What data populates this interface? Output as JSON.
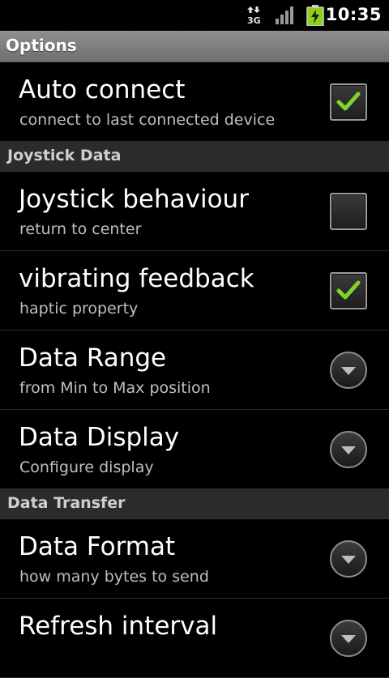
{
  "status_bar": {
    "time": "10:35",
    "network_label": "3G",
    "icons": [
      "data-arrows-icon",
      "signal-icon",
      "battery-charging-icon"
    ],
    "colors": {
      "battery": "#8fd116"
    }
  },
  "title_bar": {
    "title": "Options"
  },
  "sections": [
    {
      "type": "item",
      "title": "Auto connect",
      "summary": "connect to last connected device",
      "widget": "checkbox",
      "checked": true
    },
    {
      "type": "category",
      "title": "Joystick Data"
    },
    {
      "type": "item",
      "title": "Joystick behaviour",
      "summary": "return to center",
      "widget": "checkbox",
      "checked": false
    },
    {
      "type": "item",
      "title": "vibrating feedback",
      "summary": "haptic property",
      "widget": "checkbox",
      "checked": true
    },
    {
      "type": "item",
      "title": "Data Range",
      "summary": "from Min to Max position",
      "widget": "dropdown"
    },
    {
      "type": "item",
      "title": "Data Display",
      "summary": "Configure display",
      "widget": "dropdown"
    },
    {
      "type": "category",
      "title": "Data Transfer"
    },
    {
      "type": "item",
      "title": "Data Format",
      "summary": "how many bytes to send",
      "widget": "dropdown"
    },
    {
      "type": "item",
      "title": "Refresh interval",
      "summary": "",
      "widget": "dropdown"
    }
  ],
  "colors": {
    "check_mark": "#7fd32a",
    "title_bar": "#7f7f7f",
    "category_bg": "#2b2b2b"
  }
}
